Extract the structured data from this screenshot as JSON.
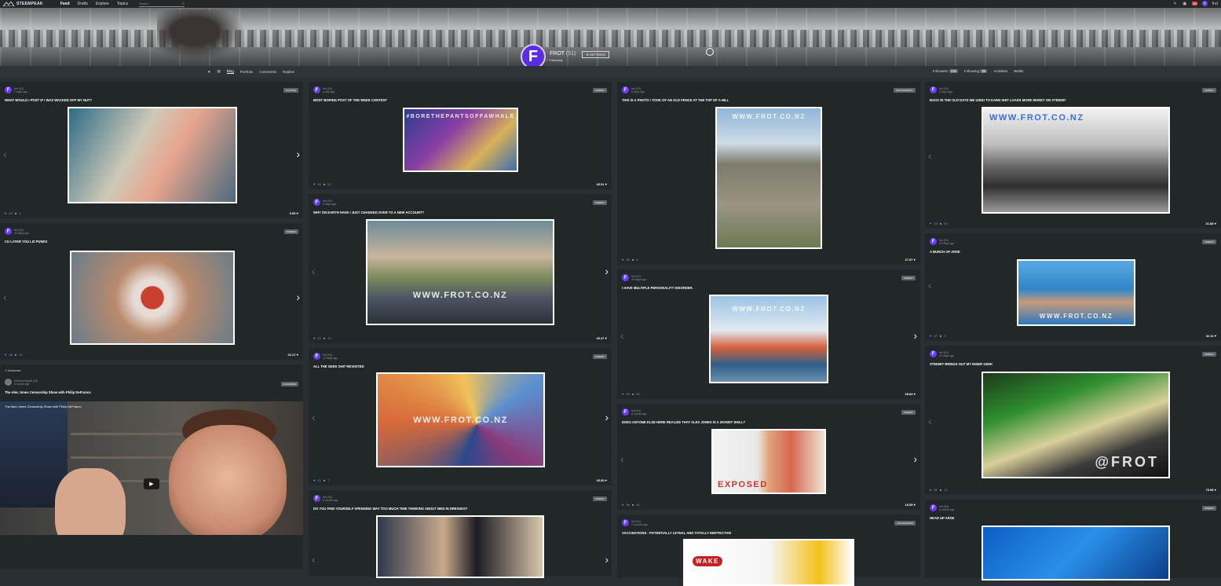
{
  "topbar": {
    "brand": "STEEMPEAK",
    "nav": [
      "Feed",
      "Drafts",
      "Explore",
      "Topics"
    ],
    "search_placeholder": "Search",
    "notification_count": "10",
    "user_initial": "F",
    "user_short": "frot"
  },
  "profile": {
    "initial": "F",
    "name": "FROT",
    "reputation": "(51)",
    "following_label": "Following",
    "settings_label": "SETTINGS"
  },
  "subnav": {
    "left_tabs": [
      "Blog",
      "Portfolio",
      "Comments",
      "Replies"
    ],
    "active_tab": "Blog",
    "right_tabs": [
      {
        "label": "Followers",
        "count": "238"
      },
      {
        "label": "Following",
        "count": "88"
      },
      {
        "label": "Activities"
      },
      {
        "label": "Wallet"
      }
    ]
  },
  "columns": [
    [
      {
        "author": "frot (51)",
        "time": "7 days ago",
        "tag": "FLOYDSA",
        "title": "WHAT WOULD I POST IF I WAS WACKED OFF MY NUT?",
        "watermark": "",
        "votes": "24",
        "comments": "3",
        "payout": "0.99"
      },
      {
        "author": "frot (51)",
        "time": "12 days ago",
        "tag": "STEEMIT",
        "title": "CU LATER YOU LIZ PUNKS",
        "watermark": "",
        "votes": "30",
        "comments": "12",
        "payout": "22.17"
      }
    ],
    [
      {
        "author": "frot (51)",
        "time": "a day ago",
        "tag": "STEEMIT",
        "title": "MOST BORING POST OF THE WEEK CONTEST",
        "watermark": "#BORETHEPANTSOFFAWHALE",
        "votes": "40",
        "comments": "22",
        "payout": "45.51"
      },
      {
        "author": "frot (51)",
        "time": "6 days ago",
        "tag": "STEEMIT",
        "title": "WHY ON EARTH HAVE I JUST CHANGED OVER TO A NEW ACCOUNT?",
        "watermark": "WWW.FROT.CO.NZ",
        "votes": "22",
        "comments": "14",
        "payout": "40.47"
      },
      {
        "author": "frot (51)",
        "time": "14 days ago",
        "tag": "STEEMIT",
        "title": "ALL THE GEEK SHIT REVISITED",
        "watermark": "WWW.FROT.CO.NZ",
        "votes": "22",
        "comments": "7",
        "payout": "45.39"
      },
      {
        "author": "frot (51)",
        "time": "a month ago",
        "tag": "STEEMIT",
        "title": "DO YOU FIND YOURSELF SPENDING WAY TOO MUCH TIME THINKING ABOUT MEN IN DRESSES?",
        "watermark": "",
        "votes": "",
        "comments": "",
        "payout": ""
      }
    ],
    [
      {
        "author": "frot (51)",
        "time": "5 days ago",
        "tag": "PHOTOGRAPHY",
        "title": "THIS IS A PHOTO I TOOK OF AN OLD FENCE AT THE TOP OF A HILL",
        "watermark": "WWW.FROT.CO.NZ",
        "votes": "49",
        "comments": "8",
        "payout": "27.57"
      },
      {
        "author": "frot (51)",
        "time": "16 days ago",
        "tag": "STEEMIT",
        "title": "I HAVE MULTIPLE PERSONALITY DISORDER.",
        "watermark": "WWW.FROT.CO.NZ",
        "votes": "40",
        "comments": "22",
        "payout": "28.84"
      },
      {
        "author": "frot (51)",
        "time": "a month ago",
        "tag": "STEEMIT",
        "title": "DOES ANYONE ELSE HERE REALISE THAT ALEX JONES IS A ZIONIST SHILL?",
        "watermark": "EXPOSED",
        "votes": "36",
        "comments": "40",
        "payout": "18.55"
      },
      {
        "author": "frot (51)",
        "time": "2 months ago",
        "tag": "VACCINATIONS",
        "title": "VACCINATIONS - POTENTIALLY LETHAL AND TOTALLY INEFFECTIVE",
        "watermark": "WAKE",
        "votes": "",
        "comments": "",
        "payout": ""
      }
    ],
    [
      {
        "author": "frot (51)",
        "time": "3 days ago",
        "tag": "STEEMIT",
        "title": "BACK IN THE OLD DAYS WE USED TO EARN SHIT LOADS MORE MONEY ON STEEMIT",
        "watermark": "WWW.FROT.CO.NZ",
        "votes": "43",
        "comments": "20",
        "payout": "31.88"
      },
      {
        "author": "frot (51)",
        "time": "12 days ago",
        "tag": "STEEMIT",
        "title": "A BUNCH OF ARSE",
        "watermark": "WWW.FROT.CO.NZ",
        "votes": "47",
        "comments": "9",
        "payout": "32.11"
      },
      {
        "author": "frot (51)",
        "time": "16 days ago",
        "tag": "STEEMIT",
        "title": "STEEMIT BRINGS OUT MY INNER GEEK",
        "watermark": "@FROT",
        "votes": "51",
        "comments": "12",
        "payout": "75.98"
      },
      {
        "author": "frot (51)",
        "time": "a month ago",
        "tag": "STEEMIT",
        "title": "HEAD UP ARSE",
        "watermark": "",
        "votes": "",
        "comments": "",
        "payout": ""
      }
    ]
  ],
  "video_card": {
    "resteemed": "resteemed",
    "author": "thedesiredpath (55)",
    "time": "a month ago",
    "tag": "ALEXJONES",
    "title": "The Alex Jones Censorship Show with Philip DeFranco",
    "player_title": "The Alex Jones Censorship Show with Philip DeFranco"
  },
  "colors": {
    "accent": "#6b3df0",
    "upvote": "#4aa3ff",
    "card_bg": "#22272a",
    "page_bg": "#2a2f33"
  }
}
